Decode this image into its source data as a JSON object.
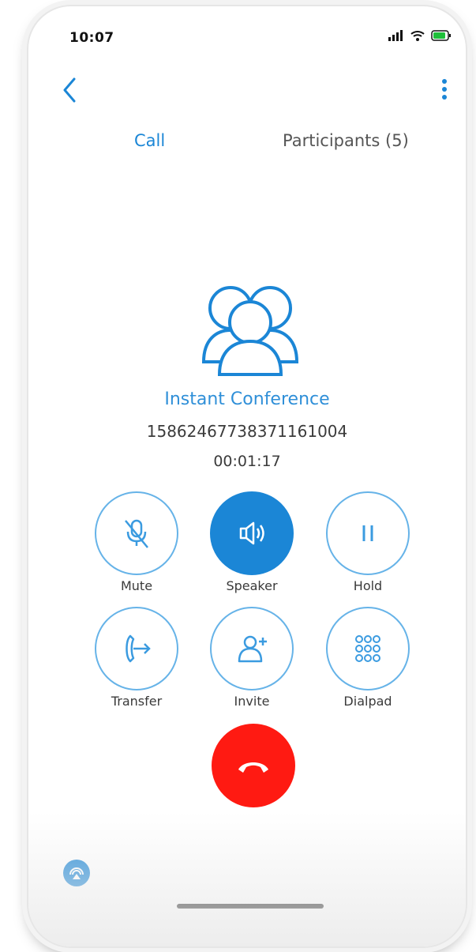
{
  "status_bar": {
    "time": "10:07"
  },
  "tabs": [
    {
      "label": "Call"
    },
    {
      "label": "Participants (5)"
    }
  ],
  "conference": {
    "title": "Instant Conference",
    "number": "15862467738371161004",
    "duration": "00:01:17"
  },
  "controls": {
    "mute": "Mute",
    "speaker": "Speaker",
    "hold": "Hold",
    "transfer": "Transfer",
    "invite": "Invite",
    "dialpad": "Dialpad"
  },
  "colors": {
    "accent": "#1b86d6",
    "end_call": "#ff1a12"
  },
  "icons": [
    "back-arrow",
    "more-vertical",
    "group",
    "mic-off",
    "speaker",
    "pause",
    "transfer",
    "add-person",
    "dialpad-grid",
    "phone-hangup",
    "airplay"
  ]
}
